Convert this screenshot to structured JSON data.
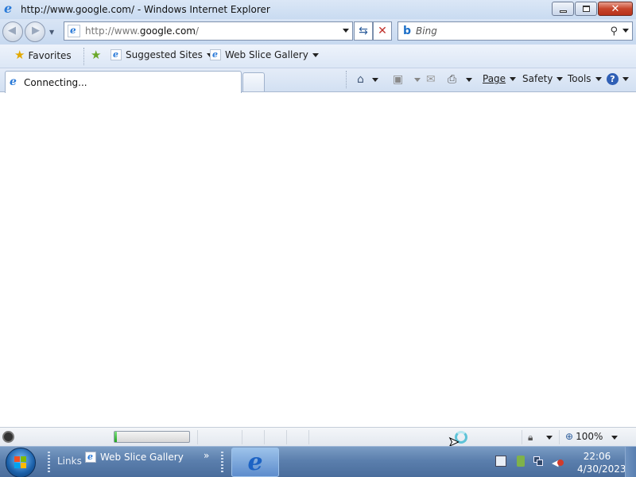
{
  "window": {
    "title": "http://www.google.com/ - Windows Internet Explorer"
  },
  "address_bar": {
    "prefix": "http://www.",
    "domain": "google.com",
    "suffix": "/"
  },
  "search": {
    "placeholder": "Bing"
  },
  "favorites_bar": {
    "favorites_label": "Favorites",
    "suggested_sites_label": "Suggested Sites",
    "web_slice_gallery_label": "Web Slice Gallery"
  },
  "tab": {
    "label": "Connecting..."
  },
  "command_bar": {
    "page_label": "Page",
    "safety_label": "Safety",
    "tools_label": "Tools"
  },
  "status_bar": {
    "zoom": "100%",
    "progress": 0.03
  },
  "taskbar": {
    "links_label": "Links",
    "web_slice_gallery_label": "Web Slice Gallery",
    "chevron": "»",
    "time": "22:06",
    "date": "4/30/2023"
  },
  "colors": {
    "accent": "#2a7ad8",
    "chrome": "#d9e5f5",
    "taskbar": "#5b7fad"
  }
}
